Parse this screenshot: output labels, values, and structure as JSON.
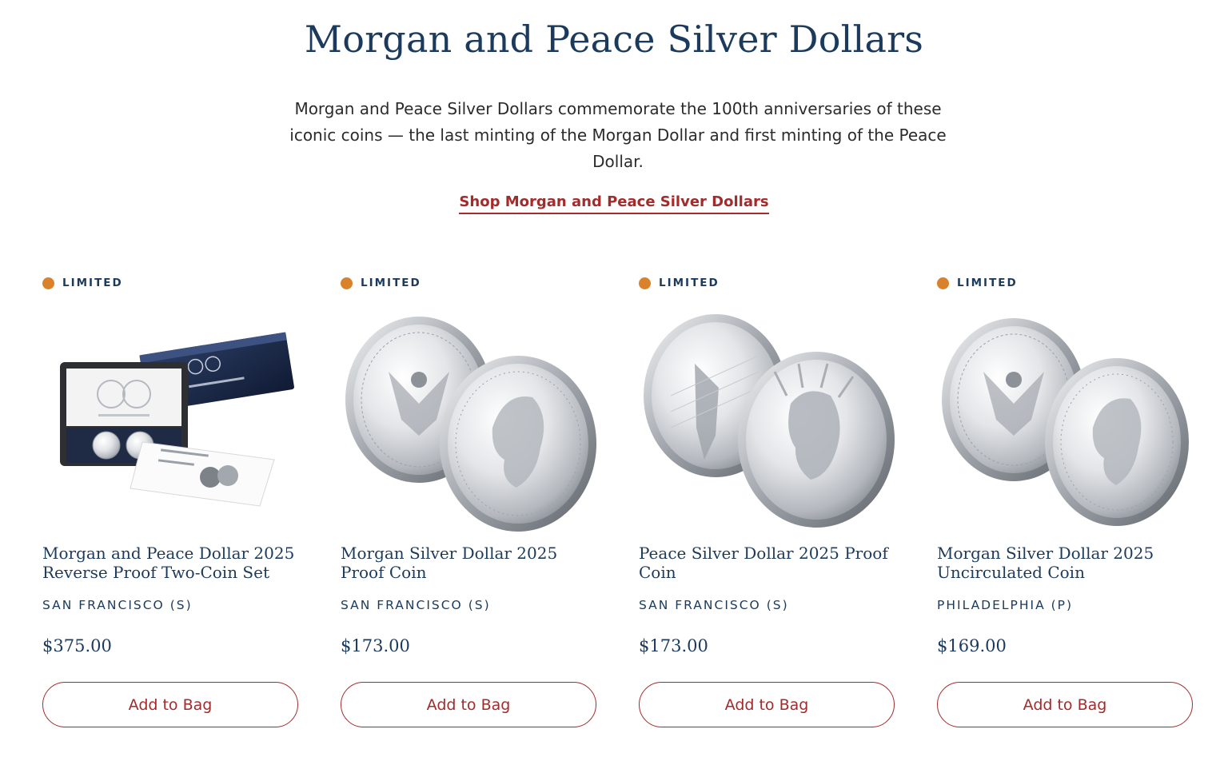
{
  "header": {
    "title": "Morgan and Peace Silver Dollars",
    "intro": "Morgan and Peace Silver Dollars commemorate the 100th anniversaries of these iconic coins — the last minting of the Morgan Dollar and first minting of the Peace Dollar.",
    "shop_link": "Shop Morgan and Peace Silver Dollars"
  },
  "colors": {
    "title": "#1b3a5c",
    "link_accent": "#a42b2b",
    "badge_dot": "#d9822b"
  },
  "products": [
    {
      "badge": "LIMITED",
      "name": "Morgan and Peace Dollar 2025 Reverse Proof Two-Coin Set",
      "mint": "SAN FRANCISCO (S)",
      "price": "$375.00",
      "button": "Add to Bag",
      "image_icon": "two-coin-set-box-image"
    },
    {
      "badge": "LIMITED",
      "name": "Morgan Silver Dollar 2025 Proof Coin",
      "mint": "SAN FRANCISCO (S)",
      "price": "$173.00",
      "button": "Add to Bag",
      "image_icon": "morgan-dollar-coins-image"
    },
    {
      "badge": "LIMITED",
      "name": "Peace Silver Dollar 2025 Proof Coin",
      "mint": "SAN FRANCISCO (S)",
      "price": "$173.00",
      "button": "Add to Bag",
      "image_icon": "peace-dollar-coins-image"
    },
    {
      "badge": "LIMITED",
      "name": "Morgan Silver Dollar 2025 Uncirculated Coin",
      "mint": "PHILADELPHIA (P)",
      "price": "$169.00",
      "button": "Add to Bag",
      "image_icon": "morgan-dollar-uncirculated-coins-image"
    }
  ]
}
